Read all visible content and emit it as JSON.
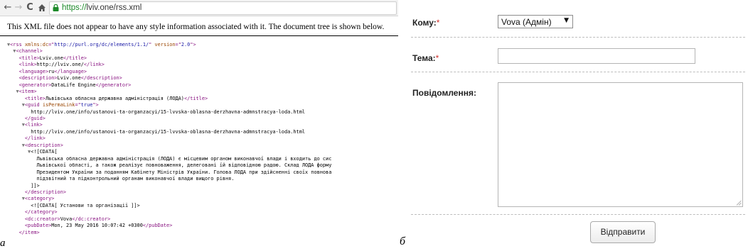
{
  "panel_a": {
    "label": "а",
    "browser": {
      "back_icon": "back-arrow-icon",
      "forward_icon": "forward-arrow-icon",
      "reload_icon": "reload-icon",
      "home_icon": "home-icon",
      "lock_icon": "lock-icon",
      "url_scheme": "https://",
      "url_rest": "lviv.one/rss.xml"
    },
    "xml_note": "This XML file does not appear to have any style information associated with it. The document tree is shown below.",
    "xml_lines": [
      [
        [
          "arrow",
          "▼"
        ],
        [
          "tag",
          "<rss "
        ],
        [
          "attr",
          "xmlns:dc"
        ],
        [
          "tag",
          "=\""
        ],
        [
          "val",
          "http://purl.org/dc/elements/1.1/"
        ],
        [
          "tag",
          "\" "
        ],
        [
          "attr",
          "version"
        ],
        [
          "tag",
          "=\""
        ],
        [
          "val",
          "2.0"
        ],
        [
          "tag",
          "\">"
        ]
      ],
      [
        [
          "arrow",
          "  ▼"
        ],
        [
          "tag",
          "<channel>"
        ]
      ],
      [
        [
          "plain",
          "    "
        ],
        [
          "tag",
          "<title>"
        ],
        [
          "plain",
          "Lviv.one"
        ],
        [
          "tag",
          "</title>"
        ]
      ],
      [
        [
          "plain",
          "    "
        ],
        [
          "tag",
          "<link>"
        ],
        [
          "plain",
          "http://lviv.one/"
        ],
        [
          "tag",
          "</link>"
        ]
      ],
      [
        [
          "plain",
          "    "
        ],
        [
          "tag",
          "<language>"
        ],
        [
          "plain",
          "ru"
        ],
        [
          "tag",
          "</language>"
        ]
      ],
      [
        [
          "plain",
          "    "
        ],
        [
          "tag",
          "<description>"
        ],
        [
          "plain",
          "Lviv.one"
        ],
        [
          "tag",
          "</description>"
        ]
      ],
      [
        [
          "plain",
          "    "
        ],
        [
          "tag",
          "<generator>"
        ],
        [
          "plain",
          "DataLife Engine"
        ],
        [
          "tag",
          "</generator>"
        ]
      ],
      [
        [
          "arrow",
          "   ▼"
        ],
        [
          "tag",
          "<item>"
        ]
      ],
      [
        [
          "plain",
          "      "
        ],
        [
          "tag",
          "<title>"
        ],
        [
          "plain",
          "Львівська обласна державна адміністрація (ЛОДА)"
        ],
        [
          "tag",
          "</title>"
        ]
      ],
      [
        [
          "arrow",
          "     ▼"
        ],
        [
          "tag",
          "<guid "
        ],
        [
          "attr",
          "isPermaLink"
        ],
        [
          "tag",
          "=\""
        ],
        [
          "val",
          "true"
        ],
        [
          "tag",
          "\">"
        ]
      ],
      [
        [
          "plain",
          "        http://lviv.one/info/ustanovi-ta-organzacyi/15-lvvska-oblasna-derzhavna-admnstracya-loda.html"
        ]
      ],
      [
        [
          "plain",
          "      "
        ],
        [
          "tag",
          "</guid>"
        ]
      ],
      [
        [
          "arrow",
          "     ▼"
        ],
        [
          "tag",
          "<link>"
        ]
      ],
      [
        [
          "plain",
          "        http://lviv.one/info/ustanovi-ta-organzacyi/15-lvvska-oblasna-derzhavna-admnstracya-loda.html"
        ]
      ],
      [
        [
          "plain",
          "      "
        ],
        [
          "tag",
          "</link>"
        ]
      ],
      [
        [
          "arrow",
          "     ▼"
        ],
        [
          "tag",
          "<description>"
        ]
      ],
      [
        [
          "arrow",
          "       ▼"
        ],
        [
          "plain",
          "<![CDATA["
        ]
      ],
      [
        [
          "plain",
          "          Львівська обласна державна адміністрація (ЛОДА) є місцевим органом виконавчої влади і входить до сис"
        ]
      ],
      [
        [
          "plain",
          "          Львівської області, а також реалізує повноваження, делеговані їй відповідною радою. Склад ЛОДА форму"
        ]
      ],
      [
        [
          "plain",
          "          Президентом України за поданням Кабінету Міністрів України. Голова ЛОДА при здійсненні своїх повнова"
        ]
      ],
      [
        [
          "plain",
          "          підзвітний та підконтрольний органам виконавчої влади вищого рівня."
        ]
      ],
      [
        [
          "plain",
          "        ]]>"
        ]
      ],
      [
        [
          "plain",
          "      "
        ],
        [
          "tag",
          "</description>"
        ]
      ],
      [
        [
          "arrow",
          "     ▼"
        ],
        [
          "tag",
          "<category>"
        ]
      ],
      [
        [
          "plain",
          "        <![CDATA[ Установи та організації ]]>"
        ]
      ],
      [
        [
          "plain",
          "      "
        ],
        [
          "tag",
          "</category>"
        ]
      ],
      [
        [
          "plain",
          "      "
        ],
        [
          "tag",
          "<dc:creator>"
        ],
        [
          "plain",
          "Vova"
        ],
        [
          "tag",
          "</dc:creator>"
        ]
      ],
      [
        [
          "plain",
          "      "
        ],
        [
          "tag",
          "<pubDate>"
        ],
        [
          "plain",
          "Mon, 23 May 2016 10:07:42 +0300"
        ],
        [
          "tag",
          "</pubDate>"
        ]
      ],
      [
        [
          "plain",
          "    "
        ],
        [
          "tag",
          "</item>"
        ]
      ]
    ]
  },
  "panel_b": {
    "label": "б",
    "to_label": "Кому:",
    "to_value": "Vova (Адмін)",
    "subject_label": "Тема:",
    "subject_value": "",
    "message_label": "Повідомлення:",
    "message_value": "",
    "required_mark": "*",
    "send_label": "Відправити",
    "dropdown_icon": "chevron-down-icon",
    "resize_icon": "resize-grip-icon",
    "colors": {
      "required": "#d0312d",
      "separator": "#bdbdbd"
    }
  }
}
